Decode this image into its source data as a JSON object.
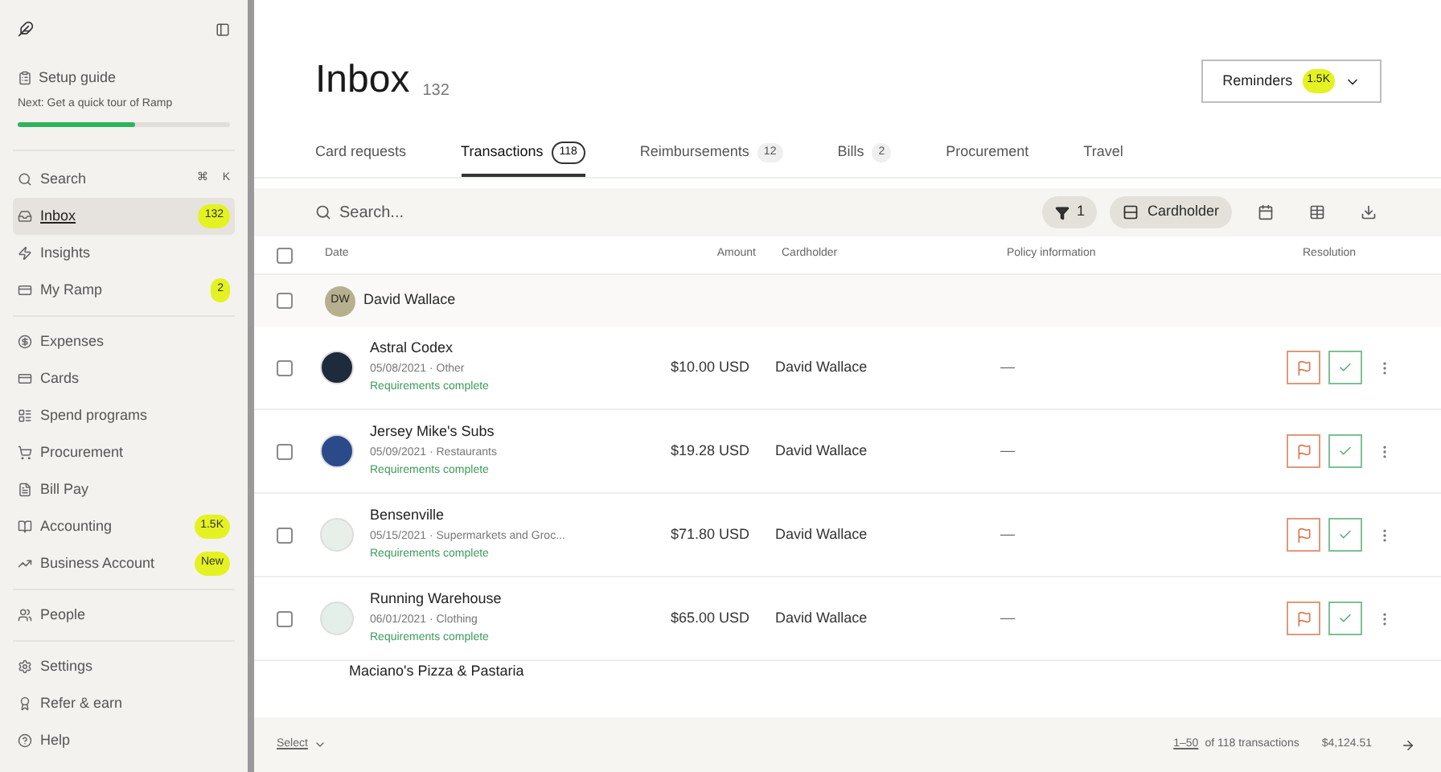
{
  "sidebar": {
    "setup": {
      "title": "Setup guide",
      "next": "Next: Get a quick tour of Ramp",
      "level": 0.55
    },
    "groups": [
      [
        {
          "label": "Search",
          "shortcut": [
            "⌘",
            "K"
          ],
          "selected": false
        },
        {
          "label": "Inbox",
          "badge": "132",
          "selected": true
        },
        {
          "label": "Insights",
          "selected": false
        },
        {
          "label": "My Ramp",
          "badge": "2",
          "selected": false
        }
      ],
      [
        {
          "label": "Expenses",
          "selected": false
        },
        {
          "label": "Cards",
          "selected": false
        },
        {
          "label": "Spend programs",
          "selected": false
        },
        {
          "label": "Procurement",
          "selected": false
        },
        {
          "label": "Bill Pay",
          "selected": false
        },
        {
          "label": "Accounting",
          "badge": "1.5K",
          "selected": false
        },
        {
          "label": "Business Account",
          "badge": "New",
          "selected": false
        }
      ],
      [
        {
          "label": "People",
          "selected": false
        }
      ],
      [
        {
          "label": "Settings",
          "selected": false
        },
        {
          "label": "Refer & earn",
          "selected": false
        },
        {
          "label": "Help",
          "selected": false
        }
      ]
    ]
  },
  "header": {
    "title": "Inbox",
    "count": "132",
    "reminders": {
      "label": "Reminders",
      "badge": "1.5K"
    }
  },
  "tabs": [
    {
      "label": "Card requests",
      "selected": false
    },
    {
      "label": "Transactions",
      "count": "118",
      "selected": true
    },
    {
      "label": "Reimbursements",
      "count": "12",
      "selected": false
    },
    {
      "label": "Bills",
      "count": "2",
      "selected": false
    },
    {
      "label": "Procurement",
      "selected": false
    },
    {
      "label": "Travel",
      "selected": false
    }
  ],
  "toolbar": {
    "search_placeholder": "Search...",
    "filter_count": "1",
    "group_by": "Cardholder"
  },
  "table": {
    "select_all_checked": false,
    "columns": [
      "Date",
      "Amount",
      "Cardholder",
      "Policy information",
      "Resolution"
    ],
    "group": {
      "initials": "DW",
      "name": "David Wallace",
      "checked": false
    },
    "rows": [
      {
        "merchant": "Astral Codex",
        "meta": "05/08/2021 · Other",
        "status": "Requirements complete",
        "amount": "$10.00 USD",
        "cardholder": "David Wallace",
        "policy": "—",
        "checked": false
      },
      {
        "merchant": "Jersey Mike's Subs",
        "meta": "05/09/2021 · Restaurants",
        "status": "Requirements complete",
        "amount": "$19.28 USD",
        "cardholder": "David Wallace",
        "policy": "—",
        "checked": false
      },
      {
        "merchant": "Bensenville",
        "meta": "05/15/2021 · Supermarkets and Groc...",
        "status": "Requirements complete",
        "amount": "$71.80 USD",
        "cardholder": "David Wallace",
        "policy": "—",
        "checked": false
      },
      {
        "merchant": "Running Warehouse",
        "meta": "06/01/2021 · Clothing",
        "status": "Requirements complete",
        "amount": "$65.00 USD",
        "cardholder": "David Wallace",
        "policy": "—",
        "checked": false
      }
    ],
    "partial_row": {
      "merchant": "Maciano's Pizza & Pastaria"
    }
  },
  "footer": {
    "select": "Select",
    "range": "1–50",
    "summary": "of 118 transactions",
    "total": "$4,124.51"
  }
}
